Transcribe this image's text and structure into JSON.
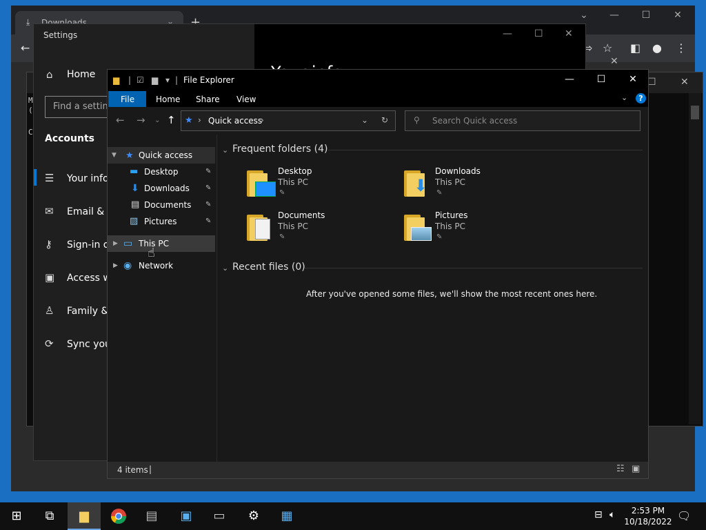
{
  "chrome": {
    "tab_title": "Downloads",
    "tab_close": "⌄",
    "new_tab": "+"
  },
  "settings": {
    "title": "Settings",
    "home": "Home",
    "search_placeholder": "Find a setting",
    "section": "Accounts",
    "peek_heading": "Your info",
    "nav": [
      {
        "label": "Your info"
      },
      {
        "label": "Email & accounts"
      },
      {
        "label": "Sign-in options"
      },
      {
        "label": "Access work or school"
      },
      {
        "label": "Family & other users"
      },
      {
        "label": "Sync your settings"
      }
    ]
  },
  "cmd": {
    "lines": [
      "M",
      "(",
      "C"
    ]
  },
  "explorer": {
    "title": "File Explorer",
    "ribbon": {
      "file": "File",
      "home": "Home",
      "share": "Share",
      "view": "View",
      "help": "?"
    },
    "address": "Quick access",
    "search_placeholder": "Search Quick access",
    "tree": {
      "quick_access": "Quick access",
      "desktop": "Desktop",
      "downloads": "Downloads",
      "documents": "Documents",
      "pictures": "Pictures",
      "this_pc": "This PC",
      "network": "Network"
    },
    "frequent_header": "Frequent folders (4)",
    "recent_header": "Recent files (0)",
    "empty_message": "After you've opened some files, we'll show the most recent ones here.",
    "folders": [
      {
        "name": "Desktop",
        "location": "This PC"
      },
      {
        "name": "Downloads",
        "location": "This PC"
      },
      {
        "name": "Documents",
        "location": "This PC"
      },
      {
        "name": "Pictures",
        "location": "This PC"
      }
    ],
    "status": "4 items"
  },
  "taskbar": {
    "time": "2:53 PM",
    "date": "10/18/2022"
  }
}
